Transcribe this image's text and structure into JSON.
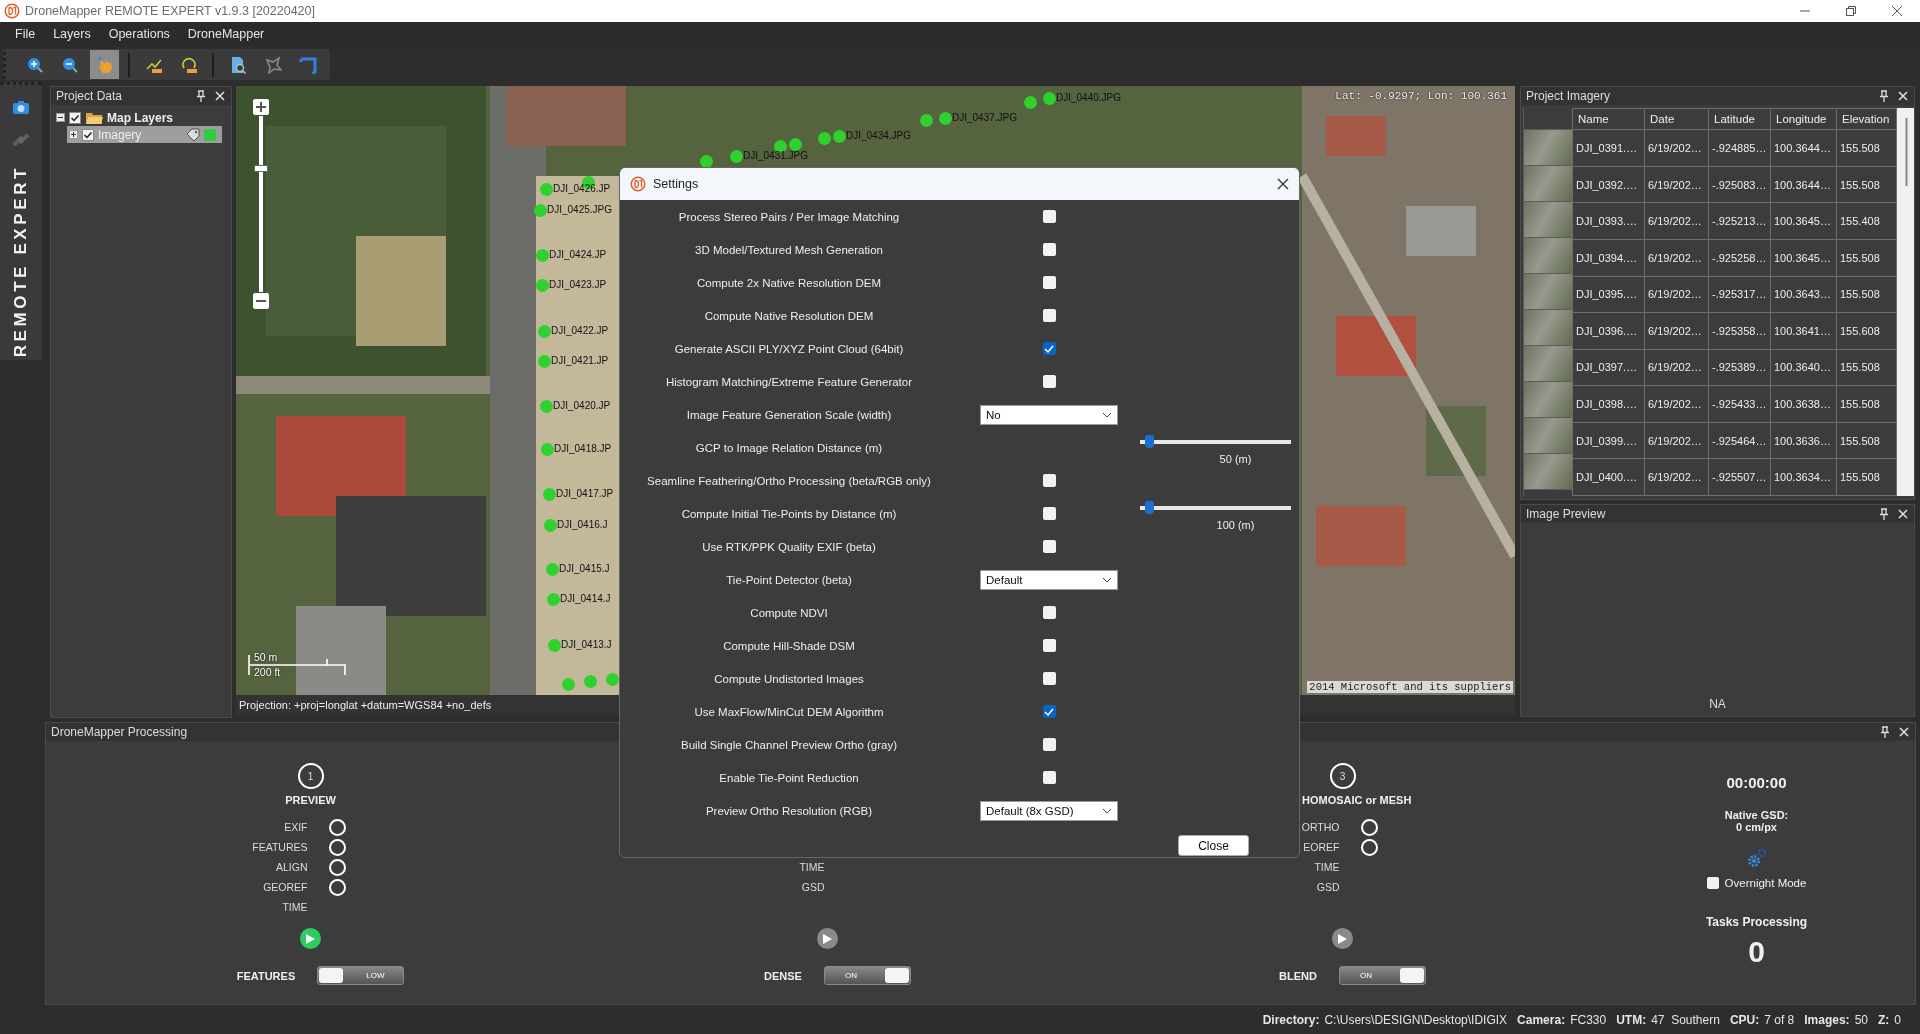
{
  "window": {
    "title": "DroneMapper REMOTE EXPERT v1.9.3 [20220420]"
  },
  "menu": [
    "File",
    "Layers",
    "Operations",
    "DroneMapper"
  ],
  "toolbar": [
    {
      "kind": "zoom-in",
      "selected": false
    },
    {
      "kind": "zoom-out",
      "selected": false
    },
    {
      "kind": "pan",
      "selected": true
    },
    {
      "kind": "separator"
    },
    {
      "kind": "measure-line",
      "selected": false
    },
    {
      "kind": "measure-area",
      "selected": false
    },
    {
      "kind": "separator"
    },
    {
      "kind": "document-search",
      "selected": false
    },
    {
      "kind": "polygon",
      "selected": false
    },
    {
      "kind": "frame",
      "selected": false
    }
  ],
  "side_strip": {
    "title": "REMOTE EXPERT",
    "tabs": [
      {
        "kind": "camera",
        "selected": true
      },
      {
        "kind": "satellite",
        "selected": false
      }
    ]
  },
  "project_data": {
    "title": "Project Data",
    "layers": [
      {
        "label": "Map Layers",
        "checked": true,
        "expanded": true,
        "selected": false,
        "children": [
          {
            "label": "Imagery",
            "checked": true,
            "expanded": false,
            "selected": true,
            "color": "#2ecc40"
          }
        ]
      }
    ]
  },
  "map": {
    "coordinates": "Lat: -0.9297; Lon: 100.361",
    "zoom": {
      "level": 0.71
    },
    "scale": [
      "50 m",
      "200 ft"
    ],
    "attribution": "2014 Microsoft and its suppliers",
    "projection": "Projection: +proj=longlat +datum=WGS84 +no_defs",
    "markers": [
      {
        "label": "DJI_0440.JPG"
      },
      {
        "label": "DJI_0437.JPG"
      },
      {
        "label": "DJI_0434.JPG"
      },
      {
        "label": "DJI_0431.JPG"
      },
      {
        "label": "DJI_0426.JP"
      },
      {
        "label": "DJI_0425.JPG"
      },
      {
        "label": "DJI_0424.JP"
      },
      {
        "label": "DJI_0423.JP"
      },
      {
        "label": "DJI_0422.JP"
      },
      {
        "label": "DJI_0421.JP"
      },
      {
        "label": "DJI_0420.JP"
      },
      {
        "label": "DJI_0418.JP"
      },
      {
        "label": "DJI_0417.JP"
      },
      {
        "label": "DJI_0416.J"
      },
      {
        "label": "DJI_0415.J"
      },
      {
        "label": "DJI_0414.J"
      },
      {
        "label": "DJI_0413.J"
      }
    ]
  },
  "project_imagery": {
    "title": "Project Imagery",
    "columns": [
      "Name",
      "Date",
      "Latitude",
      "Longitude",
      "Elevation"
    ],
    "rows": [
      [
        "DJI_0391.…",
        "6/19/202…",
        "-.924885…",
        "100.3644…",
        "155.508"
      ],
      [
        "DJI_0392.…",
        "6/19/202…",
        "-.925083…",
        "100.3644…",
        "155.508"
      ],
      [
        "DJI_0393.…",
        "6/19/202…",
        "-.925213…",
        "100.3645…",
        "155.408"
      ],
      [
        "DJI_0394.…",
        "6/19/202…",
        "-.925258…",
        "100.3645…",
        "155.508"
      ],
      [
        "DJI_0395.…",
        "6/19/202…",
        "-.925317…",
        "100.3643…",
        "155.508"
      ],
      [
        "DJI_0396.…",
        "6/19/202…",
        "-.925358…",
        "100.3641…",
        "155.608"
      ],
      [
        "DJI_0397.…",
        "6/19/202…",
        "-.925389…",
        "100.3640…",
        "155.508"
      ],
      [
        "DJI_0398.…",
        "6/19/202…",
        "-.925433…",
        "100.3638…",
        "155.508"
      ],
      [
        "DJI_0399.…",
        "6/19/202…",
        "-.925464…",
        "100.3636…",
        "155.508"
      ],
      [
        "DJI_0400.…",
        "6/19/202…",
        "-.925507…",
        "100.3634…",
        "155.508"
      ]
    ]
  },
  "image_preview": {
    "title": "Image Preview",
    "status": "NA"
  },
  "processing": {
    "title": "DroneMapper Processing",
    "steps": [
      {
        "number": "1",
        "title": "PREVIEW",
        "rows": [
          {
            "label": "EXIF",
            "kind": "status"
          },
          {
            "label": "FEATURES",
            "kind": "status"
          },
          {
            "label": "ALIGN",
            "kind": "status"
          },
          {
            "label": "GEOREF",
            "kind": "status"
          },
          {
            "label": "TIME",
            "kind": "info"
          }
        ],
        "run_enabled": true,
        "toggle": {
          "label": "FEATURES",
          "text": "LOW",
          "on": false
        }
      },
      {
        "rows": [
          {
            "label": "TIME",
            "kind": "info"
          },
          {
            "label": "GSD",
            "kind": "info"
          }
        ],
        "run_enabled": false,
        "toggle": {
          "label": "DENSE",
          "text": "ON",
          "on": true
        }
      },
      {
        "number": "3",
        "title": "HOMOSAIC or MESH",
        "rows": [
          {
            "label": "ORTHO",
            "kind": "status"
          },
          {
            "label": "EOREF",
            "kind": "status"
          },
          {
            "label": "TIME",
            "kind": "info"
          },
          {
            "label": "GSD",
            "kind": "info"
          }
        ],
        "run_enabled": false,
        "toggle": {
          "label": "BLEND",
          "text": "ON",
          "on": true
        }
      }
    ],
    "timer": "00:00:00",
    "gsd_label": "Native GSD:",
    "gsd_value": "0 cm/px",
    "overnight": {
      "label": "Overnight Mode",
      "checked": false
    },
    "tasks_label": "Tasks Processing",
    "tasks_count": "0"
  },
  "status_bar": [
    {
      "label": "Directory:",
      "value": "C:\\Users\\DESIGN\\Desktop\\IDIGIX"
    },
    {
      "label": "Camera:",
      "value": "FC330"
    },
    {
      "label": "UTM:",
      "value": "47  Southern"
    },
    {
      "label": "CPU:",
      "value": "7 of 8"
    },
    {
      "label": "Images:",
      "value": "50"
    },
    {
      "label": "Z:",
      "value": "0"
    }
  ],
  "settings": {
    "title": "Settings",
    "close_button": "Close",
    "rows": [
      {
        "label": "Process Stereo Pairs / Per Image Matching",
        "kind": "checkbox",
        "checked": false
      },
      {
        "label": "3D Model/Textured Mesh Generation",
        "kind": "checkbox",
        "checked": false
      },
      {
        "label": "Compute 2x Native Resolution DEM",
        "kind": "checkbox",
        "checked": false
      },
      {
        "label": "Compute Native Resolution DEM",
        "kind": "checkbox",
        "checked": false
      },
      {
        "label": "Generate ASCII PLY/XYZ Point Cloud (64bit)",
        "kind": "checkbox",
        "checked": true
      },
      {
        "label": "Histogram Matching/Extreme Feature Generator",
        "kind": "checkbox",
        "checked": false
      },
      {
        "label": "Image Feature Generation Scale (width)",
        "kind": "select",
        "value": "No"
      },
      {
        "label": "GCP to Image Relation Distance (m)",
        "kind": "slider",
        "level": 0.03,
        "reading": "50 (m)"
      },
      {
        "label": "Seamline Feathering/Ortho Processing (beta/RGB only)",
        "kind": "checkbox",
        "checked": false
      },
      {
        "label": "Compute Initial Tie-Points by Distance (m)",
        "kind": "checkbox-slider",
        "checked": false,
        "level": 0.03,
        "reading": "100 (m)"
      },
      {
        "label": "Use RTK/PPK Quality EXIF (beta)",
        "kind": "checkbox",
        "checked": false
      },
      {
        "label": "Tie-Point Detector (beta)",
        "kind": "select",
        "value": "Default"
      },
      {
        "label": "Compute NDVI",
        "kind": "checkbox",
        "checked": false
      },
      {
        "label": "Compute Hill-Shade DSM",
        "kind": "checkbox",
        "checked": false
      },
      {
        "label": "Compute Undistorted Images",
        "kind": "checkbox",
        "checked": false
      },
      {
        "label": "Use MaxFlow/MinCut DEM Algorithm",
        "kind": "checkbox",
        "checked": true
      },
      {
        "label": "Build Single Channel Preview Ortho (gray)",
        "kind": "checkbox",
        "checked": false
      },
      {
        "label": "Enable Tie-Point Reduction",
        "kind": "checkbox",
        "checked": false
      },
      {
        "label": "Preview Ortho Resolution (RGB)",
        "kind": "select",
        "value": "Default (8x GSD)"
      }
    ]
  }
}
